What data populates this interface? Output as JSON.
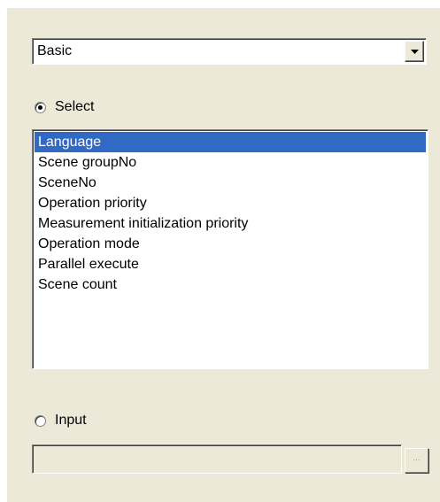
{
  "combo": {
    "value": "Basic",
    "options_selected": "Basic",
    "arrow_icon": "chevron-down-icon"
  },
  "select_radio": {
    "label": "Select",
    "checked": true
  },
  "list": {
    "items": [
      "Language",
      "Scene groupNo",
      "SceneNo",
      "Operation priority",
      "Measurement initialization priority",
      "Operation mode",
      "Parallel execute",
      "Scene count"
    ],
    "selected_index": 0
  },
  "input_radio": {
    "label": "Input",
    "checked": false
  },
  "input": {
    "value": "",
    "enabled": false,
    "browse_label": "..."
  },
  "colors": {
    "panel_bg": "#ece9d8",
    "selection": "#316ac5"
  }
}
